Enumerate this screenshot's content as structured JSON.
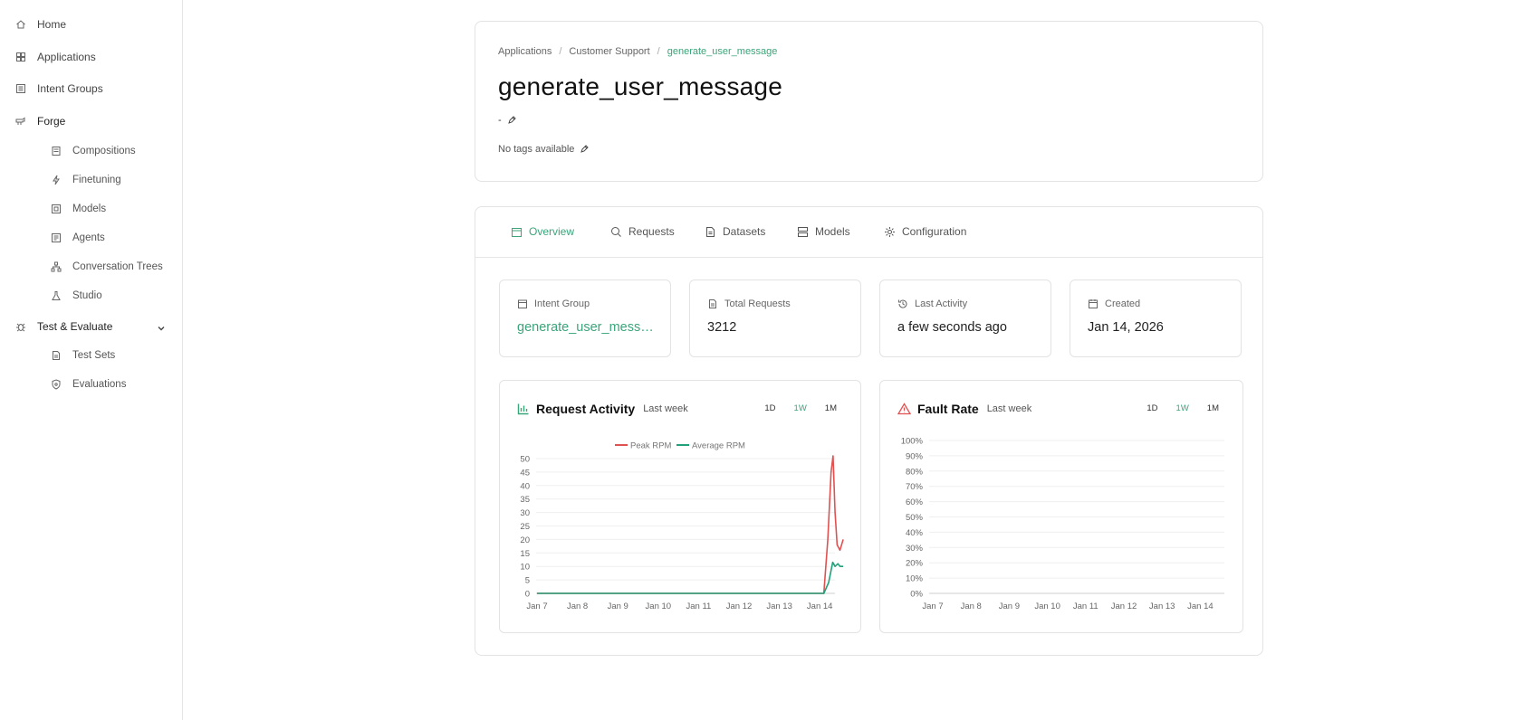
{
  "sidebar": {
    "items": [
      {
        "label": "Home",
        "icon": "home-icon"
      },
      {
        "label": "Applications",
        "icon": "grid-icon"
      },
      {
        "label": "Intent Groups",
        "icon": "list-icon"
      },
      {
        "label": "Forge",
        "icon": "forge-icon"
      }
    ],
    "forge_children": [
      {
        "label": "Compositions",
        "icon": "layers-icon"
      },
      {
        "label": "Finetuning",
        "icon": "bolt-icon"
      },
      {
        "label": "Models",
        "icon": "model-icon"
      },
      {
        "label": "Agents",
        "icon": "agent-icon"
      },
      {
        "label": "Conversation Trees",
        "icon": "tree-icon"
      },
      {
        "label": "Studio",
        "icon": "flask-icon"
      }
    ],
    "test_section": {
      "label": "Test & Evaluate",
      "icon": "bug-icon"
    },
    "test_children": [
      {
        "label": "Test Sets",
        "icon": "file-icon"
      },
      {
        "label": "Evaluations",
        "icon": "shield-icon"
      }
    ]
  },
  "header": {
    "breadcrumb": [
      "Applications",
      "Customer Support",
      "generate_user_message"
    ],
    "title": "generate_user_message",
    "description": "-",
    "tags_text": "No tags available"
  },
  "tabs": [
    {
      "label": "Overview",
      "icon": "calendar-icon",
      "active": true
    },
    {
      "label": "Requests",
      "icon": "search-icon",
      "active": false
    },
    {
      "label": "Datasets",
      "icon": "document-icon",
      "active": false
    },
    {
      "label": "Models",
      "icon": "server-icon",
      "active": false
    },
    {
      "label": "Configuration",
      "icon": "gear-icon",
      "active": false
    }
  ],
  "stats": [
    {
      "label": "Intent Group",
      "value": "generate_user_message",
      "icon": "calendar-icon",
      "accent": true
    },
    {
      "label": "Total Requests",
      "value": "3212",
      "icon": "document-icon",
      "accent": false
    },
    {
      "label": "Last Activity",
      "value": "a few seconds ago",
      "icon": "history-icon",
      "accent": false
    },
    {
      "label": "Created",
      "value": "Jan 14, 2026",
      "icon": "calendar-icon",
      "accent": false
    }
  ],
  "colors": {
    "accent": "#3aa57a",
    "peak": "#e05252",
    "average": "#22a07a",
    "fault": "#e05252"
  },
  "charts": {
    "request_activity": {
      "title": "Request Activity",
      "subtitle": "Last week",
      "ranges": [
        "1D",
        "1W",
        "1M"
      ],
      "active_range": "1W"
    },
    "fault_rate": {
      "title": "Fault Rate",
      "subtitle": "Last week",
      "ranges": [
        "1D",
        "1W",
        "1M"
      ],
      "active_range": "1W"
    }
  },
  "chart_data": [
    {
      "type": "line",
      "title": "Request Activity",
      "subtitle": "Last week",
      "x_ticks": [
        "Jan 7",
        "Jan 8",
        "Jan 9",
        "Jan 10",
        "Jan 11",
        "Jan 12",
        "Jan 13",
        "Jan 14"
      ],
      "ylim": [
        0,
        50
      ],
      "y_ticks": [
        0,
        5,
        10,
        15,
        20,
        25,
        30,
        35,
        40,
        45,
        50
      ],
      "legend": "top-center",
      "grid": true,
      "series": [
        {
          "name": "Peak RPM",
          "color": "#e05252",
          "points": [
            [
              0,
              0
            ],
            [
              1,
              0
            ],
            [
              2,
              0
            ],
            [
              3,
              0
            ],
            [
              4,
              0
            ],
            [
              5,
              0
            ],
            [
              6,
              0
            ],
            [
              7,
              0
            ],
            [
              7.1,
              0
            ],
            [
              7.2,
              20
            ],
            [
              7.28,
              45
            ],
            [
              7.33,
              51
            ],
            [
              7.38,
              30
            ],
            [
              7.43,
              18
            ],
            [
              7.5,
              16
            ],
            [
              7.58,
              20
            ]
          ]
        },
        {
          "name": "Average RPM",
          "color": "#22a07a",
          "points": [
            [
              0,
              0
            ],
            [
              1,
              0
            ],
            [
              2,
              0
            ],
            [
              3,
              0
            ],
            [
              4,
              0
            ],
            [
              5,
              0
            ],
            [
              6,
              0
            ],
            [
              7,
              0
            ],
            [
              7.1,
              0
            ],
            [
              7.22,
              4
            ],
            [
              7.32,
              11.5
            ],
            [
              7.38,
              10
            ],
            [
              7.45,
              11
            ],
            [
              7.5,
              10
            ],
            [
              7.58,
              10
            ]
          ]
        }
      ]
    },
    {
      "type": "line",
      "title": "Fault Rate",
      "subtitle": "Last week",
      "x_ticks": [
        "Jan 7",
        "Jan 8",
        "Jan 9",
        "Jan 10",
        "Jan 11",
        "Jan 12",
        "Jan 13",
        "Jan 14"
      ],
      "ylim": [
        0,
        100
      ],
      "y_ticks": [
        "0%",
        "10%",
        "20%",
        "30%",
        "40%",
        "50%",
        "60%",
        "70%",
        "80%",
        "90%",
        "100%"
      ],
      "grid": true,
      "series": []
    }
  ]
}
